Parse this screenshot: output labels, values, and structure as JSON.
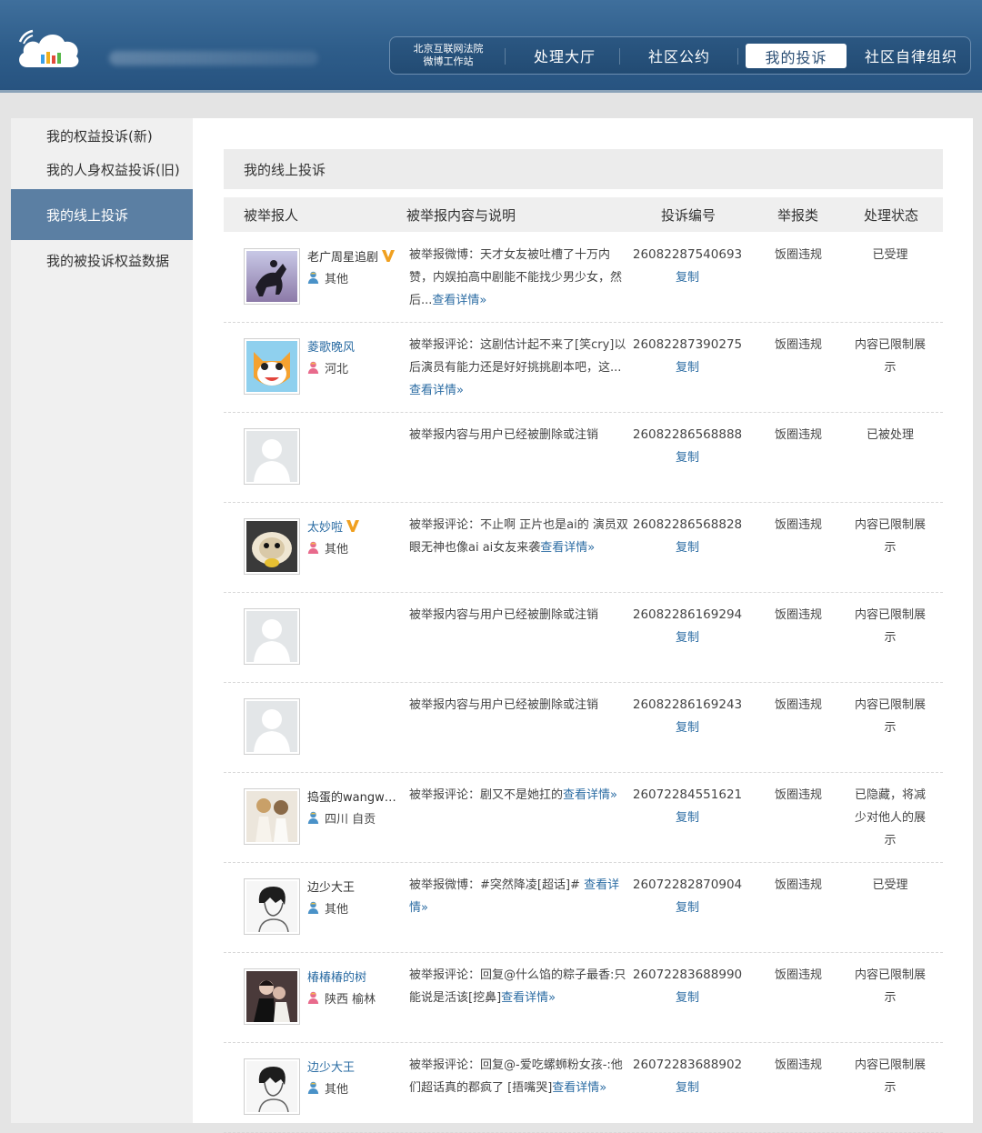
{
  "header": {
    "court_line1": "北京互联网法院",
    "court_line2": "微博工作站",
    "nav": [
      {
        "label": "处理大厅",
        "active": false
      },
      {
        "label": "社区公约",
        "active": false
      },
      {
        "label": "我的投诉",
        "active": true
      },
      {
        "label": "社区自律组织",
        "active": false
      }
    ]
  },
  "sidebar": {
    "items": [
      {
        "label": "我的权益投诉(新)",
        "active": false
      },
      {
        "label": "我的人身权益投诉(旧)",
        "active": false
      },
      {
        "label": "我的线上投诉",
        "active": true
      },
      {
        "label": "我的被投诉权益数据",
        "active": false
      }
    ]
  },
  "main": {
    "title": "我的线上投诉",
    "columns": [
      "被举报人",
      "被举报内容与说明",
      "投诉编号",
      "举报类",
      "处理状态"
    ],
    "copy_label": "复制",
    "rows": [
      {
        "avatar": "horse-rider",
        "name": "老广周星追剧",
        "name_link": false,
        "verified": true,
        "gender": "male",
        "location": "其他",
        "content": "被举报微博：天才女友被吐槽了十万内赞，内娱拍高中剧能不能找少男少女，然后...",
        "more": "查看详情»",
        "id": "26082287540693",
        "type": "饭圈违规",
        "status": "已受理"
      },
      {
        "avatar": "cartoon-cat",
        "name": "菱歌晚风",
        "name_link": true,
        "verified": false,
        "gender": "female",
        "location": "河北",
        "content": "被举报评论：这剧估计起不来了[笑cry]以后演员有能力还是好好挑挑剧本吧，这...",
        "more": "查看详情»",
        "id": "26082287390275",
        "type": "饭圈违规",
        "status": "内容已限制展示"
      },
      {
        "avatar": "default",
        "name": "",
        "name_link": false,
        "verified": false,
        "gender": "",
        "location": "",
        "content": "被举报内容与用户已经被删除或注销",
        "more": "",
        "id": "26082286568888",
        "type": "饭圈违规",
        "status": "已被处理"
      },
      {
        "avatar": "hamster",
        "name": "太妙啦",
        "name_link": true,
        "verified": true,
        "gender": "female",
        "location": "其他",
        "content": "被举报评论：不止啊 正片也是ai的 演员双眼无神也像ai ai女友来袭",
        "more": "查看详情»",
        "id": "26082286568828",
        "type": "饭圈违规",
        "status": "内容已限制展示"
      },
      {
        "avatar": "default",
        "name": "",
        "name_link": false,
        "verified": false,
        "gender": "",
        "location": "",
        "content": "被举报内容与用户已经被删除或注销",
        "more": "",
        "id": "26082286169294",
        "type": "饭圈违规",
        "status": "内容已限制展示"
      },
      {
        "avatar": "default",
        "name": "",
        "name_link": false,
        "verified": false,
        "gender": "",
        "location": "",
        "content": "被举报内容与用户已经被删除或注销",
        "more": "",
        "id": "26082286169243",
        "type": "饭圈违规",
        "status": "内容已限制展示"
      },
      {
        "avatar": "two-girls",
        "name": "捣蛋的wangwa...",
        "name_link": false,
        "verified": false,
        "gender": "male",
        "location": "四川 自贡",
        "content": "被举报评论：剧又不是她扛的",
        "more": "查看详情»",
        "id": "26072284551621",
        "type": "饭圈违规",
        "status": "已隐藏，将减少对他人的展示"
      },
      {
        "avatar": "sketch-boy",
        "name": "边少大王",
        "name_link": false,
        "verified": false,
        "gender": "male",
        "location": "其他",
        "content": "被举报微博：#突然降凌[超话]# ",
        "more": "查看详情»",
        "id": "26072282870904",
        "type": "饭圈违规",
        "status": "已受理"
      },
      {
        "avatar": "couple-photo",
        "name": "椿椿椿的树",
        "name_link": true,
        "verified": false,
        "gender": "female",
        "location": "陕西 榆林",
        "content": "被举报评论：回复@什么馅的粽子最香:只能说是活该[挖鼻]",
        "more": "查看详情»",
        "id": "26072283688990",
        "type": "饭圈违规",
        "status": "内容已限制展示"
      },
      {
        "avatar": "sketch-boy",
        "name": "边少大王",
        "name_link": true,
        "verified": false,
        "gender": "male",
        "location": "其他",
        "content": "被举报评论：回复@-爱吃螺蛳粉女孩-:他们超话真的郡疯了 [捂嘴哭]",
        "more": "查看详情»",
        "id": "26072283688902",
        "type": "饭圈违规",
        "status": "内容已限制展示"
      }
    ]
  },
  "colors": {
    "header_blue": "#2e5d8a",
    "sidebar_active": "#5b7fa3",
    "link_blue": "#2b6ca3",
    "verified_orange": "#f0a020"
  }
}
